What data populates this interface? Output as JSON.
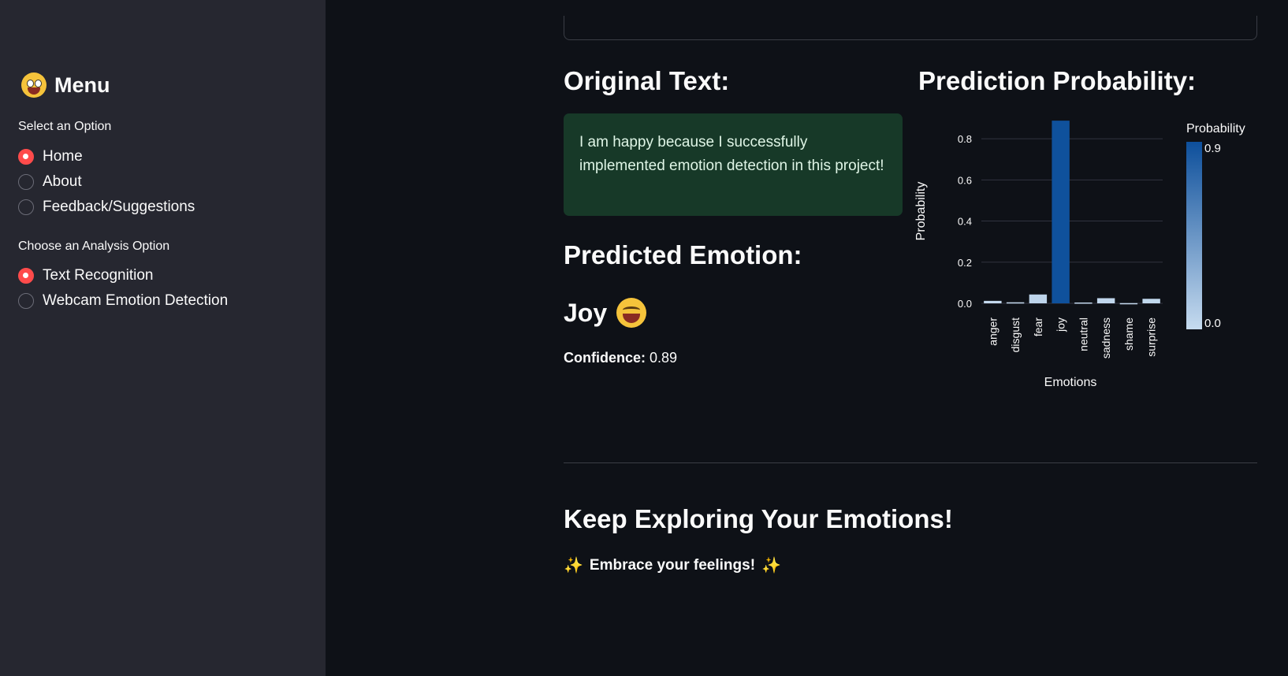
{
  "sidebar": {
    "title": "Menu",
    "select_label": "Select an Option",
    "select_options": [
      "Home",
      "About",
      "Feedback/Suggestions"
    ],
    "select_selected": 0,
    "analysis_label": "Choose an Analysis Option",
    "analysis_options": [
      "Text Recognition",
      "Webcam Emotion Detection"
    ],
    "analysis_selected": 0
  },
  "main": {
    "original_heading": "Original Text:",
    "original_text": "I am happy because I successfully implemented emotion detection in this project!",
    "predicted_heading": "Predicted Emotion:",
    "predicted_emotion": "Joy",
    "confidence_label": "Confidence:",
    "confidence_value": "0.89",
    "probability_heading": "Prediction Probability:",
    "footer_heading": "Keep Exploring Your Emotions!",
    "footer_text": "Embrace your feelings!"
  },
  "colors": {
    "accent": "#ff4b4b",
    "bar_high": "#0d4f9b",
    "bar_low": "#c6dbef"
  },
  "chart_data": {
    "type": "bar",
    "categories": [
      "anger",
      "disgust",
      "fear",
      "joy",
      "neutral",
      "sadness",
      "shame",
      "surprise"
    ],
    "values": [
      0.012,
      0.005,
      0.043,
      0.888,
      0.004,
      0.025,
      0.001,
      0.022
    ],
    "xlabel": "Emotions",
    "ylabel": "Probability",
    "ylim": [
      0,
      0.9
    ],
    "yticks": [
      "0.0",
      "0.2",
      "0.4",
      "0.6",
      "0.8"
    ],
    "ytick_values": [
      0,
      0.2,
      0.4,
      0.6,
      0.8
    ],
    "legend_title": "Probability",
    "legend_max": "0.9",
    "legend_min": "0.0",
    "grid": true,
    "legend_position": "right"
  }
}
